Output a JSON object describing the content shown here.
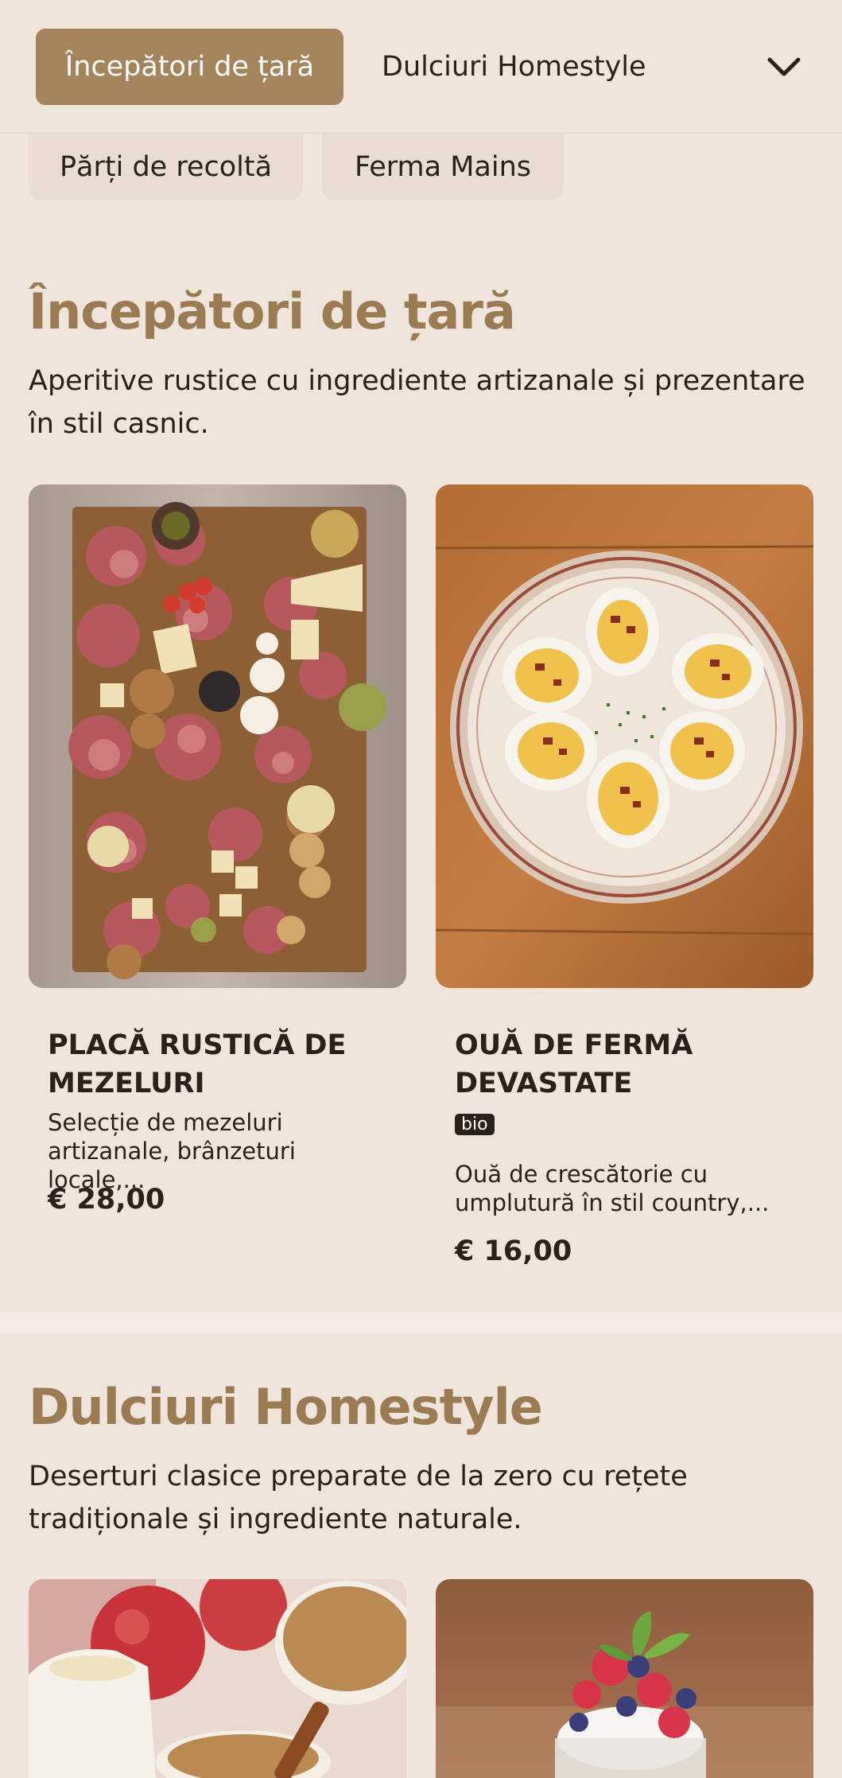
{
  "topbar": {
    "active_tab": "Începători de țară",
    "second_tab": "Dulciuri Homestyle",
    "chips": [
      "Părți de recoltă",
      "Ferma Mains"
    ]
  },
  "sections": [
    {
      "title": "Începători de țară",
      "description": "Aperitive rustice cu ingrediente artizanale și prezentare în stil casnic.",
      "items": [
        {
          "name": "PLACĂ RUSTICĂ DE MEZELURI",
          "description": "Selecție de mezeluri artizanale, brânzeturi locale,...",
          "price": "€ 28,00"
        },
        {
          "name": "OUĂ DE FERMĂ DEVASTATE",
          "badge": "bio",
          "description": "Ouă de crescătorie cu umplutură în stil country,...",
          "price": "€ 16,00"
        }
      ]
    },
    {
      "title": "Dulciuri Homestyle",
      "description": "Deserturi clasice preparate de la zero cu rețete tradiționale și ingrediente naturale."
    }
  ],
  "icons": {
    "dropdown": "chevron-down-icon"
  },
  "colors": {
    "accent": "#a4845a",
    "title": "#9a7b52",
    "background": "#efe5dd"
  }
}
